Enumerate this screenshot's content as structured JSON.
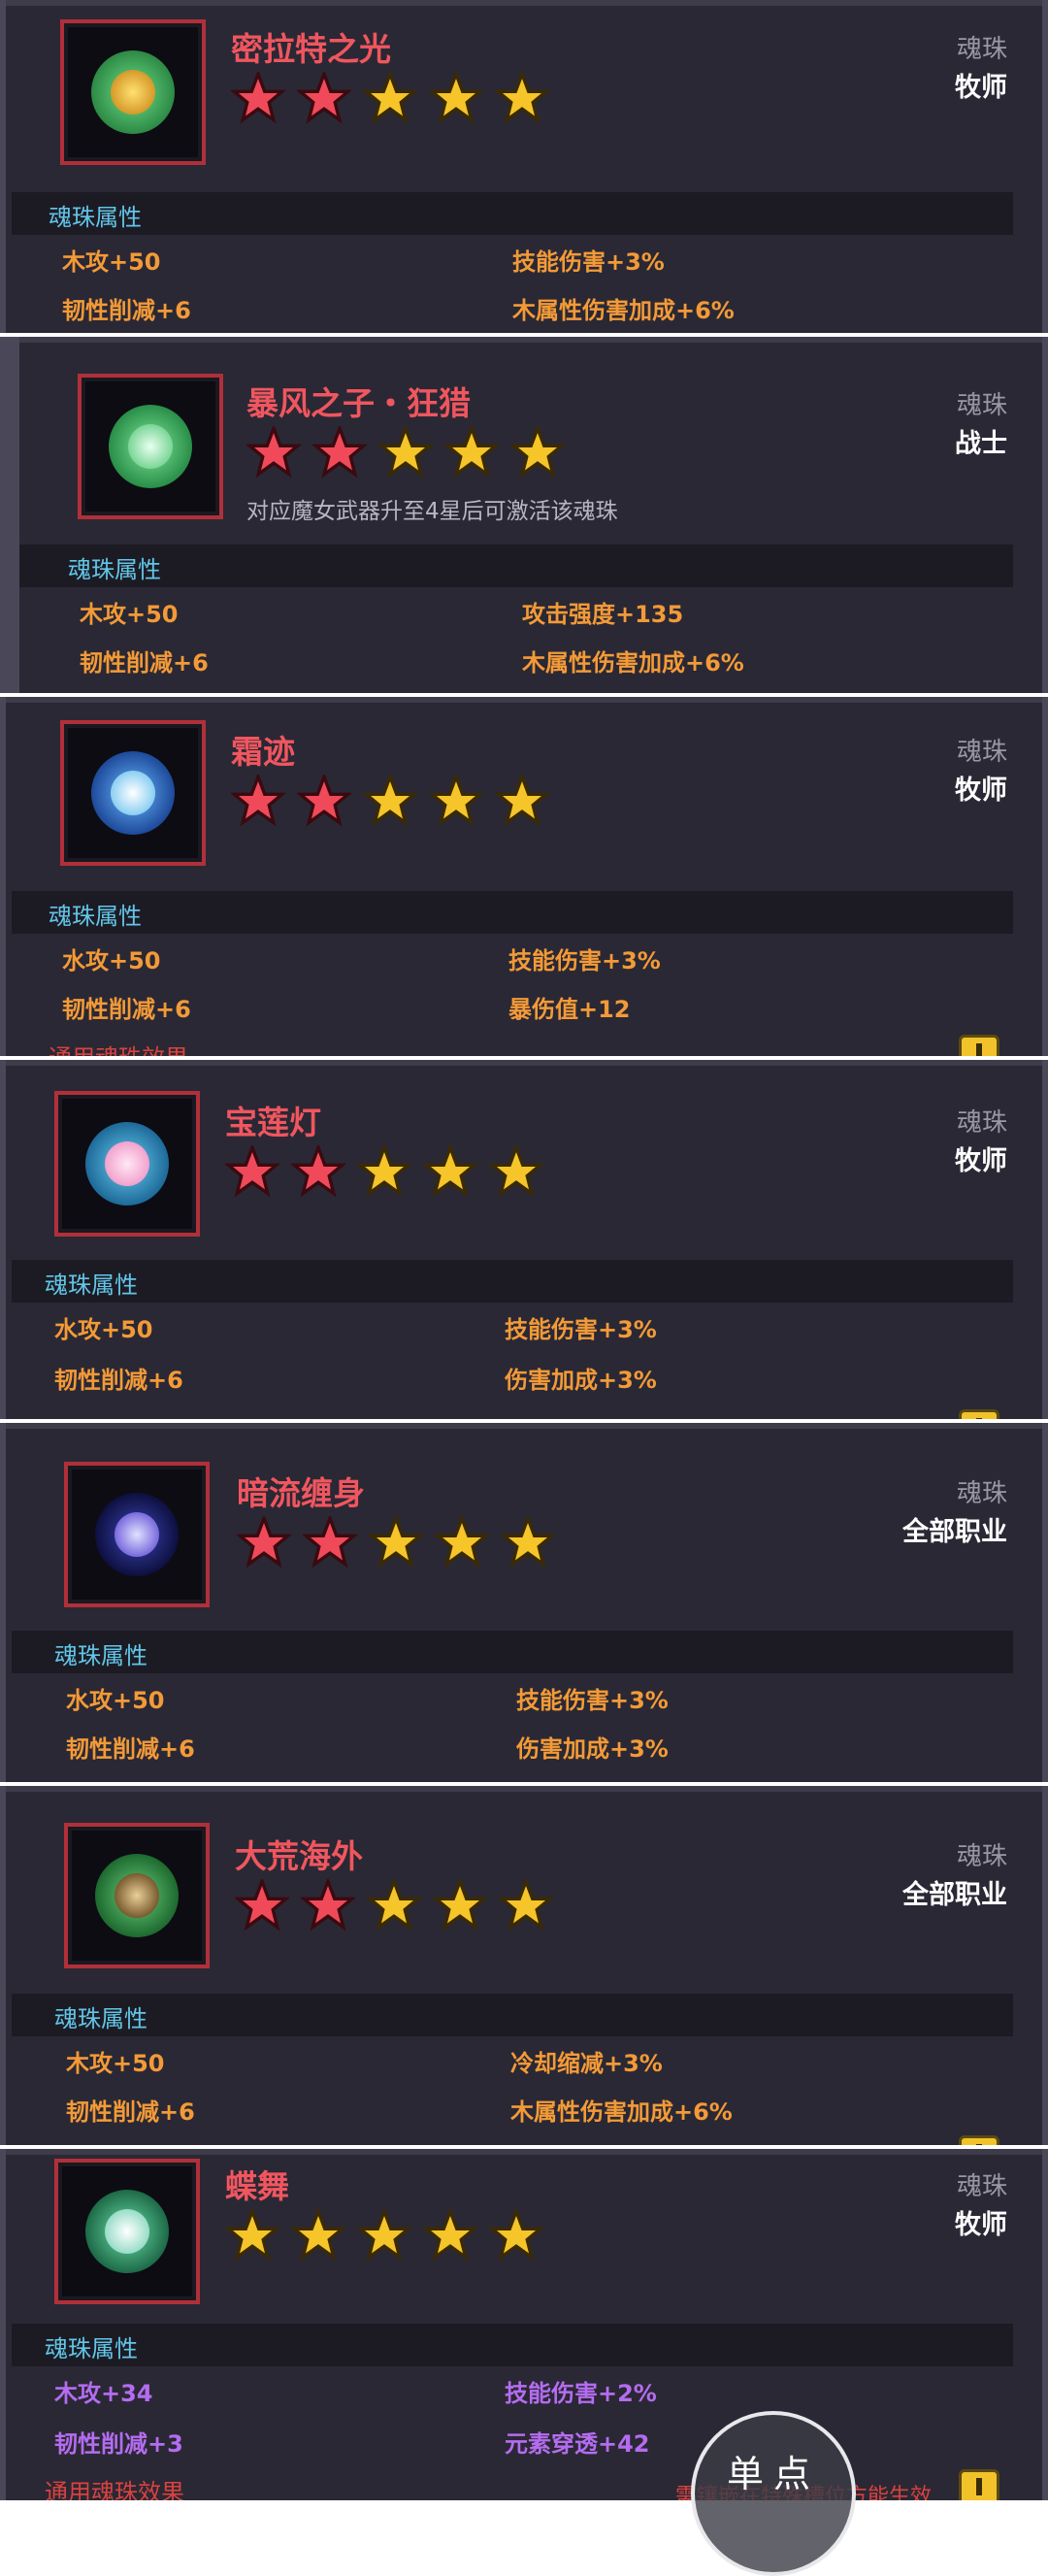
{
  "section_title": "魂珠属性",
  "type_label": "魂珠",
  "cards": [
    {
      "name": "密拉特之光",
      "class": "牧师",
      "stars": [
        "red",
        "red",
        "gold",
        "gold",
        "gold"
      ],
      "orb_color": "#46c36e",
      "orb_inner": "#f0c030",
      "stats": [
        "木攻+50",
        "技能伤害+3%",
        "韧性削减+6",
        "木属性伤害加成+6%"
      ],
      "stat_color": "orange"
    },
    {
      "name": "暴风之子・狂猎",
      "class": "战士",
      "desc": "对应魔女武器升至4星后可激活该魂珠",
      "stars": [
        "red",
        "red",
        "gold",
        "gold",
        "gold"
      ],
      "orb_color": "#3fae5a",
      "orb_inner": "#a8f0b8",
      "stats": [
        "木攻+50",
        "攻击强度+135",
        "韧性削减+6",
        "木属性伤害加成+6%"
      ],
      "stat_color": "orange"
    },
    {
      "name": "霜迹",
      "class": "牧师",
      "stars": [
        "red",
        "red",
        "gold",
        "gold",
        "gold"
      ],
      "orb_color": "#3a7ad8",
      "orb_inner": "#bfe8ff",
      "stats": [
        "水攻+50",
        "技能伤害+3%",
        "韧性削减+6",
        "暴伤值+12"
      ],
      "stat_color": "orange",
      "partial_text": "通用魂珠效果"
    },
    {
      "name": "宝莲灯",
      "class": "牧师",
      "stars": [
        "red",
        "red",
        "gold",
        "gold",
        "gold"
      ],
      "orb_color": "#2f8fb8",
      "orb_inner": "#ffc0e0",
      "stats": [
        "水攻+50",
        "技能伤害+3%",
        "韧性削减+6",
        "伤害加成+3%"
      ],
      "stat_color": "orange"
    },
    {
      "name": "暗流缠身",
      "class": "全部职业",
      "stars": [
        "red",
        "red",
        "gold",
        "gold",
        "gold"
      ],
      "orb_color": "#1c1f6a",
      "orb_inner": "#8a7af0",
      "stats": [
        "水攻+50",
        "技能伤害+3%",
        "韧性削减+6",
        "伤害加成+3%"
      ],
      "stat_color": "orange"
    },
    {
      "name": "大荒海外",
      "class": "全部职业",
      "stars": [
        "red",
        "red",
        "gold",
        "gold",
        "gold"
      ],
      "orb_color": "#3d9a4a",
      "orb_inner": "#c7a15a",
      "stats": [
        "木攻+50",
        "冷却缩减+3%",
        "韧性削减+6",
        "木属性伤害加成+6%"
      ],
      "stat_color": "orange"
    },
    {
      "name": "蝶舞",
      "class": "牧师",
      "stars": [
        "gold",
        "gold",
        "gold",
        "gold",
        "gold"
      ],
      "orb_color": "#2e9a64",
      "orb_inner": "#b8f0d8",
      "stats": [
        "木攻+34",
        "技能伤害+2%",
        "韧性削减+3",
        "元素穿透+42"
      ],
      "stat_color": "purple",
      "partial_text": "通用魂珠效果",
      "partial_right": "需镶嵌在特殊槽位方能生效"
    }
  ],
  "tap_label": "单点",
  "colors": {
    "name": "#f0565f",
    "attr_title": "#62c6e8",
    "stat_orange": "#f39a38",
    "stat_purple": "#b46cf0",
    "card_bg": "#2a2834"
  }
}
